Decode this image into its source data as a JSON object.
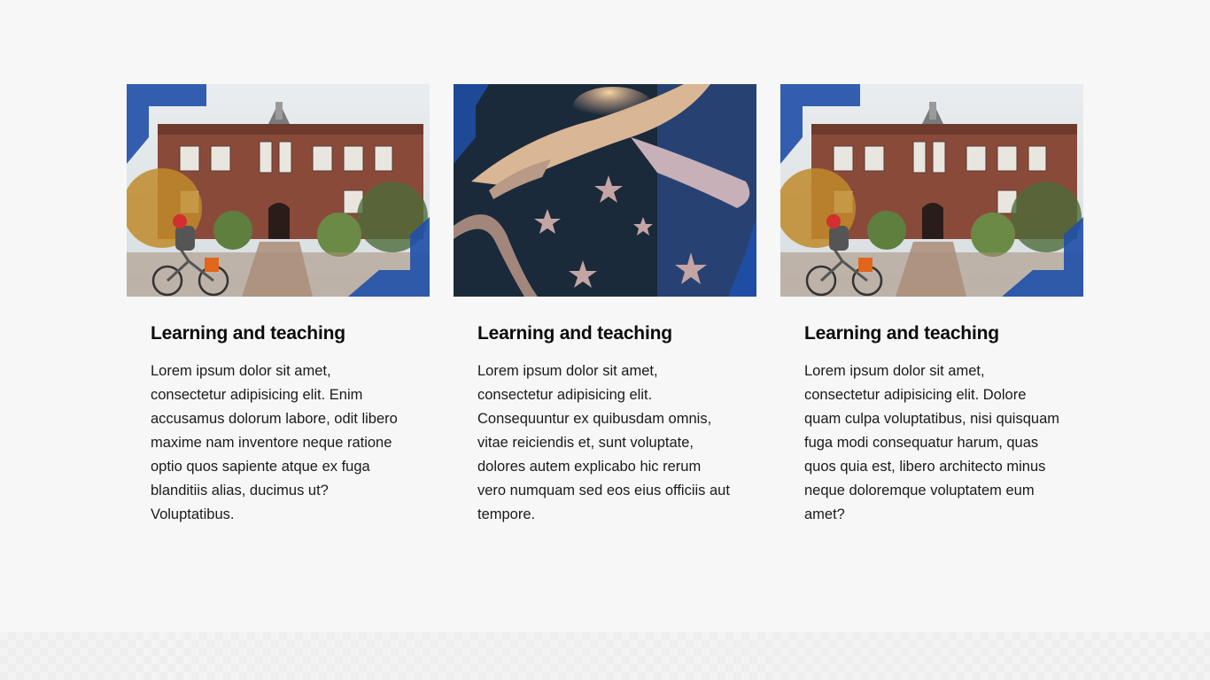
{
  "cards": [
    {
      "image": "campus-building-with-cyclist",
      "title": "Learning and teaching",
      "text": "Lorem ipsum dolor sit amet, consectetur adipisicing elit. Enim accusamus dolorum labore, odit libero maxime nam inventore neque ratione optio quos sapiente atque ex fuga blanditiis alias, ducimus ut? Voluptatibus."
    },
    {
      "image": "eagle-and-stars-emblem",
      "title": "Learning and teaching",
      "text": "Lorem ipsum dolor sit amet, consectetur adipisicing elit. Consequuntur ex quibusdam omnis, vitae reiciendis et, sunt voluptate, dolores autem explicabo hic rerum vero numquam sed eos eius officiis aut tempore."
    },
    {
      "image": "campus-building-with-cyclist",
      "title": "Learning and teaching",
      "text": "Lorem ipsum dolor sit amet, consectetur adipisicing elit. Dolore quam culpa voluptatibus, nisi quisquam fuga modi consequatur harum, quas quos quia est, libero architecto minus neque doloremque voluptatem eum amet?"
    }
  ],
  "colors": {
    "background": "#f7f7f7",
    "accent_blue": "#1f4fa8",
    "title": "#0b0b0b",
    "text": "#1a1a1a"
  }
}
